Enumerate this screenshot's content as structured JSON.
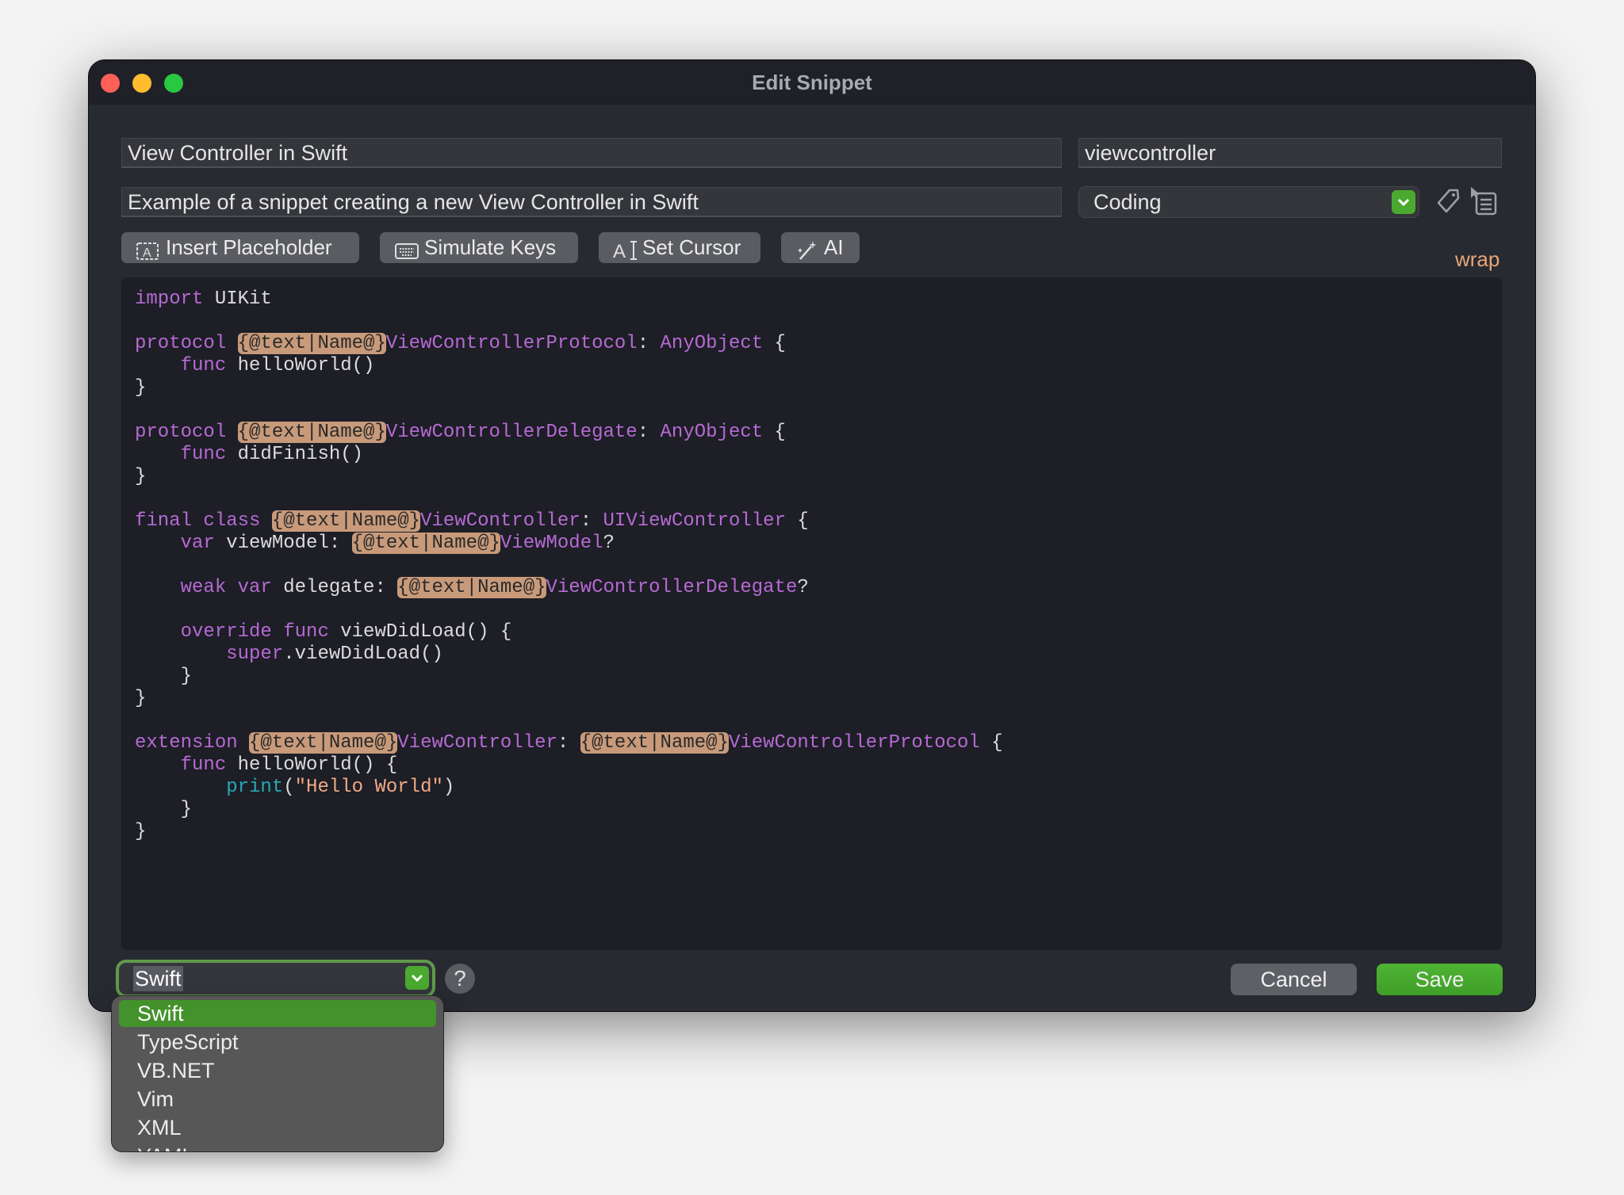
{
  "window": {
    "title": "Edit Snippet"
  },
  "colors": {
    "accent_green": "#4aaa30",
    "placeholder_bg": "#c89a7a",
    "keyword": "#b66ad3",
    "wrap": "#e9a679"
  },
  "form": {
    "name_value": "View Controller in Swift",
    "keyword_value": "viewcontroller",
    "description_value": "Example of a snippet creating a new View Controller in Swift",
    "group_value": "Coding"
  },
  "toolbar": {
    "insert_placeholder": "Insert Placeholder",
    "simulate_keys": "Simulate Keys",
    "set_cursor": "Set Cursor",
    "ai": "AI",
    "wrap": "wrap"
  },
  "icons": {
    "tag": "tag-icon",
    "list": "list-icon",
    "help": "help-icon"
  },
  "editor": {
    "lines": [
      [
        [
          "k",
          "import"
        ],
        [
          "p",
          " UIKit"
        ]
      ],
      [],
      [
        [
          "k",
          "protocol"
        ],
        [
          "p",
          " "
        ],
        [
          "ph",
          "{@text|Name@}"
        ],
        [
          "ty",
          "ViewControllerProtocol"
        ],
        [
          "p",
          ": "
        ],
        [
          "ty",
          "AnyObject"
        ],
        [
          "p",
          " {"
        ]
      ],
      [
        [
          "p",
          "    "
        ],
        [
          "k",
          "func"
        ],
        [
          "p",
          " helloWorld()"
        ]
      ],
      [
        [
          "p",
          "}"
        ]
      ],
      [],
      [
        [
          "k",
          "protocol"
        ],
        [
          "p",
          " "
        ],
        [
          "ph",
          "{@text|Name@}"
        ],
        [
          "ty",
          "ViewControllerDelegate"
        ],
        [
          "p",
          ": "
        ],
        [
          "ty",
          "AnyObject"
        ],
        [
          "p",
          " {"
        ]
      ],
      [
        [
          "p",
          "    "
        ],
        [
          "k",
          "func"
        ],
        [
          "p",
          " didFinish()"
        ]
      ],
      [
        [
          "p",
          "}"
        ]
      ],
      [],
      [
        [
          "k",
          "final class"
        ],
        [
          "p",
          " "
        ],
        [
          "ph",
          "{@text|Name@}"
        ],
        [
          "ty",
          "ViewController"
        ],
        [
          "p",
          ": "
        ],
        [
          "ty",
          "UIViewController"
        ],
        [
          "p",
          " {"
        ]
      ],
      [
        [
          "p",
          "    "
        ],
        [
          "k",
          "var"
        ],
        [
          "p",
          " viewModel: "
        ],
        [
          "ph",
          "{@text|Name@}"
        ],
        [
          "ty",
          "ViewModel"
        ],
        [
          "p",
          "?"
        ]
      ],
      [],
      [
        [
          "p",
          "    "
        ],
        [
          "k",
          "weak var"
        ],
        [
          "p",
          " delegate: "
        ],
        [
          "ph",
          "{@text|Name@}"
        ],
        [
          "ty",
          "ViewControllerDelegate"
        ],
        [
          "p",
          "?"
        ]
      ],
      [],
      [
        [
          "p",
          "    "
        ],
        [
          "k",
          "override func"
        ],
        [
          "p",
          " viewDidLoad() {"
        ]
      ],
      [
        [
          "p",
          "        "
        ],
        [
          "k",
          "super"
        ],
        [
          "p",
          ".viewDidLoad()"
        ]
      ],
      [
        [
          "p",
          "    }"
        ]
      ],
      [
        [
          "p",
          "}"
        ]
      ],
      [],
      [
        [
          "k",
          "extension"
        ],
        [
          "p",
          " "
        ],
        [
          "ph",
          "{@text|Name@}"
        ],
        [
          "ty",
          "ViewController"
        ],
        [
          "p",
          ": "
        ],
        [
          "ph",
          "{@text|Name@}"
        ],
        [
          "ty",
          "ViewControllerProtocol"
        ],
        [
          "p",
          " {"
        ]
      ],
      [
        [
          "p",
          "    "
        ],
        [
          "k",
          "func"
        ],
        [
          "p",
          " helloWorld() {"
        ]
      ],
      [
        [
          "p",
          "        "
        ],
        [
          "fn",
          "print"
        ],
        [
          "p",
          "("
        ],
        [
          "s",
          "\"Hello World\""
        ],
        [
          "p",
          ")"
        ]
      ],
      [
        [
          "p",
          "    }"
        ]
      ],
      [
        [
          "p",
          "}"
        ]
      ]
    ]
  },
  "footer": {
    "language_value": "Swift",
    "help": "?",
    "cancel": "Cancel",
    "save": "Save"
  },
  "language_menu": {
    "items": [
      "Swift",
      "TypeScript",
      "VB.NET",
      "Vim",
      "XML",
      "YAML"
    ],
    "selected": "Swift"
  }
}
